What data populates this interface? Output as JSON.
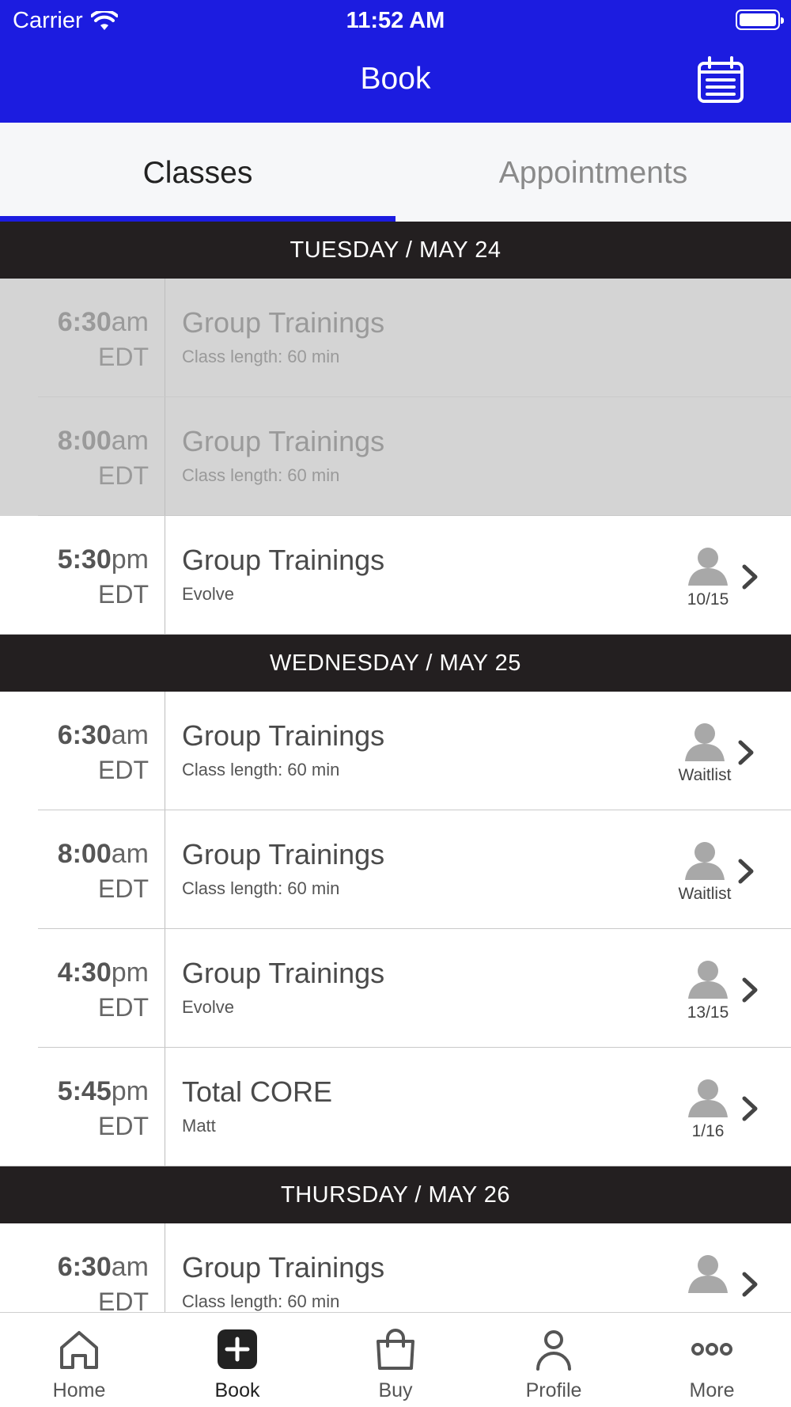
{
  "status_bar": {
    "carrier": "Carrier",
    "time": "11:52 AM"
  },
  "header": {
    "title": "Book"
  },
  "tabs": [
    {
      "label": "Classes",
      "active": true
    },
    {
      "label": "Appointments",
      "active": false
    }
  ],
  "days": [
    {
      "header": "TUESDAY / MAY 24",
      "classes": [
        {
          "time": "6:30",
          "ampm": "am",
          "tz": "EDT",
          "name": "Group Trainings",
          "sub": "Class length: 60 min",
          "past": true,
          "spots": ""
        },
        {
          "time": "8:00",
          "ampm": "am",
          "tz": "EDT",
          "name": "Group Trainings",
          "sub": "Class length: 60 min",
          "past": true,
          "spots": ""
        },
        {
          "time": "5:30",
          "ampm": "pm",
          "tz": "EDT",
          "name": "Group Trainings",
          "sub": "Evolve",
          "past": false,
          "spots": "10/15"
        }
      ]
    },
    {
      "header": "WEDNESDAY / MAY 25",
      "classes": [
        {
          "time": "6:30",
          "ampm": "am",
          "tz": "EDT",
          "name": "Group Trainings",
          "sub": "Class length: 60 min",
          "past": false,
          "spots": "Waitlist"
        },
        {
          "time": "8:00",
          "ampm": "am",
          "tz": "EDT",
          "name": "Group Trainings",
          "sub": "Class length: 60 min",
          "past": false,
          "spots": "Waitlist"
        },
        {
          "time": "4:30",
          "ampm": "pm",
          "tz": "EDT",
          "name": "Group Trainings",
          "sub": "Evolve",
          "past": false,
          "spots": "13/15"
        },
        {
          "time": "5:45",
          "ampm": "pm",
          "tz": "EDT",
          "name": "Total CORE",
          "sub": "Matt",
          "past": false,
          "spots": "1/16"
        }
      ]
    },
    {
      "header": "THURSDAY / MAY 26",
      "classes": [
        {
          "time": "6:30",
          "ampm": "am",
          "tz": "EDT",
          "name": "Group Trainings",
          "sub": "Class length: 60 min",
          "past": false,
          "spots": ""
        }
      ]
    }
  ],
  "bottom_nav": [
    {
      "label": "Home",
      "icon": "home-icon"
    },
    {
      "label": "Book",
      "icon": "plus-square-icon",
      "active": true
    },
    {
      "label": "Buy",
      "icon": "shopping-bag-icon"
    },
    {
      "label": "Profile",
      "icon": "person-icon"
    },
    {
      "label": "More",
      "icon": "more-icon"
    }
  ],
  "colors": {
    "brand": "#1c1ce0",
    "day_header": "#231f20",
    "past_row": "#d4d4d4"
  }
}
